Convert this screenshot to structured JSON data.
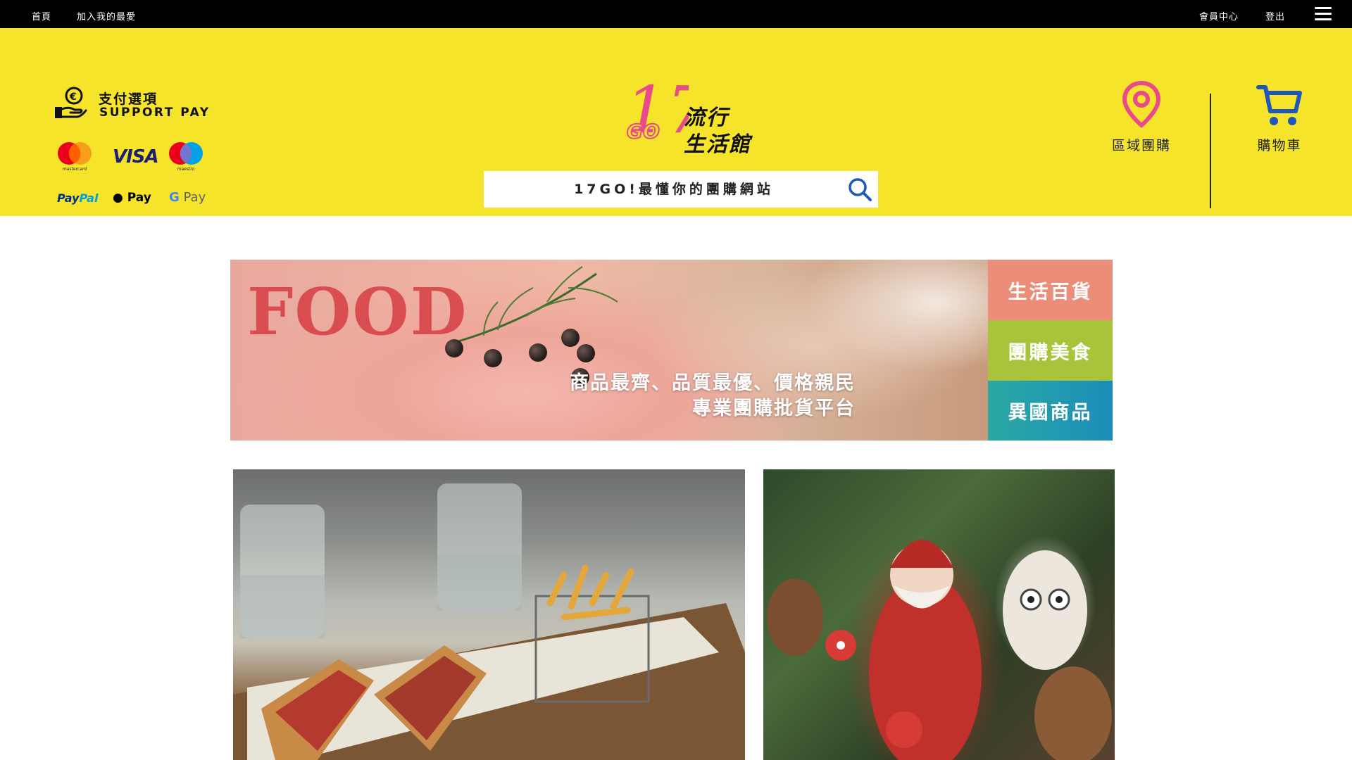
{
  "topbar": {
    "home": "首頁",
    "favorite": "加入我的最愛",
    "member": "會員中心",
    "logout": "登出"
  },
  "payment": {
    "title_zh": "支付選項",
    "title_en": "SUPPORT PAY",
    "methods": [
      "mastercard",
      "VISA",
      "maestro",
      "PayPal",
      "Pay",
      "G Pay"
    ],
    "mastercard_caption": "mastercard",
    "visa": "VISA",
    "maestro_caption": "maestro",
    "paypal_a": "Pay",
    "paypal_b": "Pal",
    "apple_pay": " Pay",
    "gpay_g": "G",
    "gpay_rest": " Pay"
  },
  "logo": {
    "number": "17",
    "go": "GO",
    "line1": "流行",
    "line2": "生活館"
  },
  "search": {
    "placeholder": "17GO!最懂你的團購網站"
  },
  "nav": {
    "region": "區域團購",
    "cart": "購物車"
  },
  "banner": {
    "word": "FOOD",
    "slogan_line1": "商品最齊、品質最優、價格親民",
    "slogan_line2": "專業團購批貨平台"
  },
  "categories": [
    "生活百貨",
    "團購美食",
    "異國商品"
  ],
  "colors": {
    "header_bg": "#f6e42a",
    "topbar_bg": "#000000",
    "accent_pink": "#e84a8a",
    "cat_life": "#ec8d7a",
    "cat_food": "#a8c43a",
    "cat_foreign": "#1b8ebb"
  }
}
